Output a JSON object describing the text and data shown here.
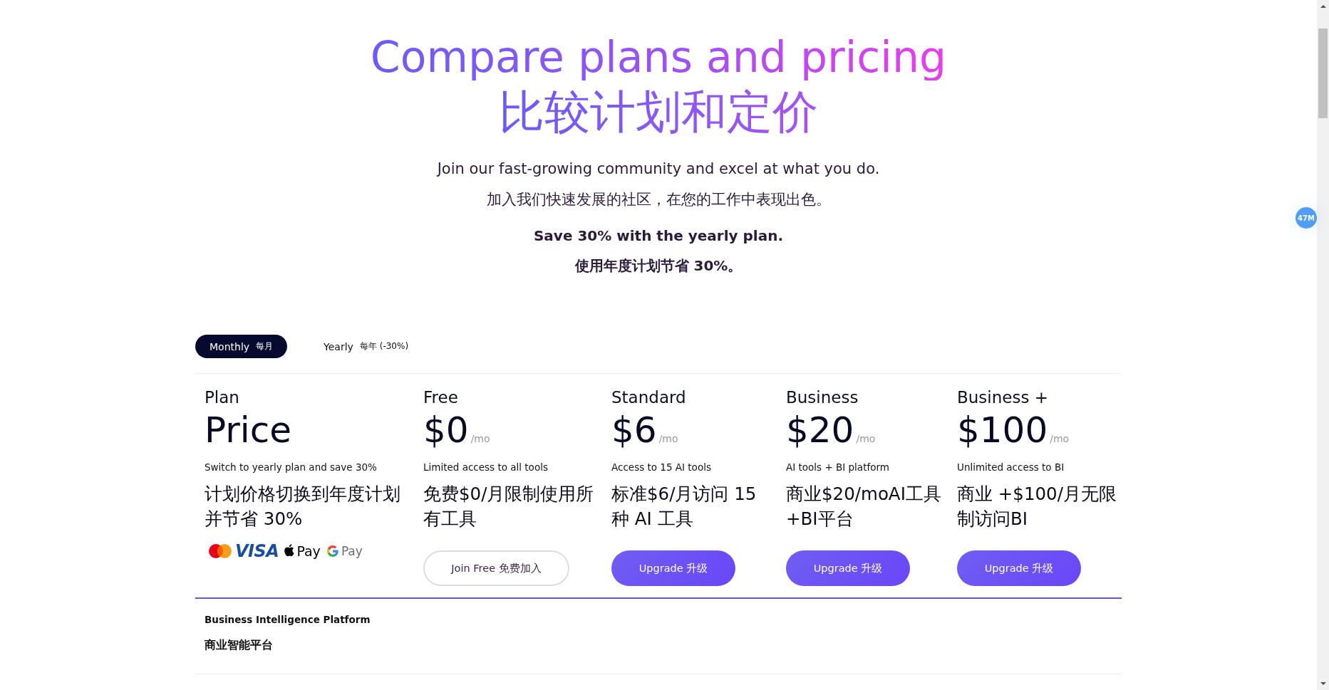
{
  "header": {
    "title": "Compare plans and pricing",
    "title_zh": "比较计划和定价",
    "subtitle": "Join our fast-growing community and excel at what you do.",
    "subtitle_zh": "加入我们快速发展的社区，在您的工作中表现出色。",
    "promo": "Save 30% with the yearly plan.",
    "promo_zh": "使用年度计划节省 30%。"
  },
  "billing_toggle": [
    {
      "label": "Monthly",
      "label_zh": "每月",
      "selected": true
    },
    {
      "label": "Yearly",
      "label_zh": "每年 (-30%)",
      "selected": false
    }
  ],
  "pricing_table": {
    "label_column": {
      "plan": "Plan",
      "price": "Price",
      "note": "Switch to yearly plan and save 30%",
      "note_zh": "计划价格切换到年度计划并节省 30%",
      "payment_methods": [
        {
          "kind": "mastercard"
        },
        {
          "kind": "visa",
          "label": "VISA"
        },
        {
          "kind": "apple_pay",
          "label": "Pay"
        },
        {
          "kind": "google_pay",
          "label": "Pay"
        }
      ]
    },
    "plans": [
      {
        "name": "Free",
        "price": "$0",
        "period": "/mo",
        "summary": "Limited access to all tools",
        "summary_zh": "免费$0/月限制使用所有工具",
        "button": {
          "label": "Join Free 免费加入",
          "kind": "outline"
        }
      },
      {
        "name": "Standard",
        "price": "$6",
        "period": "/mo",
        "summary": "Access to 15 AI tools",
        "summary_zh": "标准$6/月访问 15 种 AI 工具",
        "button": {
          "label": "Upgrade 升级",
          "kind": "primary"
        }
      },
      {
        "name": "Business",
        "price": "$20",
        "period": "/mo",
        "summary": "AI tools + BI platform",
        "summary_zh": "商业$20/moAI工具+BI平台",
        "button": {
          "label": "Upgrade 升级",
          "kind": "primary"
        }
      },
      {
        "name": "Business +",
        "price": "$100",
        "period": "/mo",
        "summary": "Unlimited access to BI",
        "summary_zh": "商业 +$100/月无限制访问BI",
        "button": {
          "label": "Upgrade 升级",
          "kind": "primary"
        }
      }
    ]
  },
  "section": {
    "title": "Business Intelligence Platform",
    "title_zh": "商业智能平台"
  },
  "floating_badge": "47M"
}
